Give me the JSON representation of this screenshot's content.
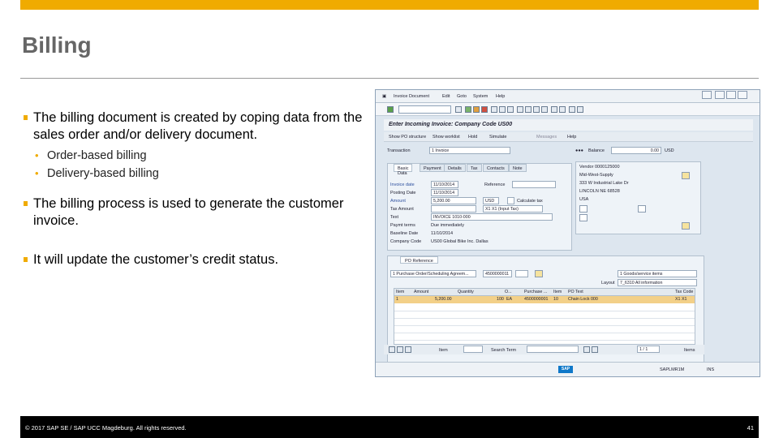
{
  "slide": {
    "title": "Billing",
    "bullets": [
      {
        "text": "The billing document is created by coping data from the sales order and/or delivery document.",
        "sub": [
          "Order-based billing",
          "Delivery-based billing"
        ]
      },
      {
        "text": "The billing process is used to generate the customer invoice.",
        "sub": []
      },
      {
        "text": "It will update the customer’s credit status.",
        "sub": []
      }
    ],
    "footer": {
      "copyright": "© 2017 SAP SE / SAP UCC Magdeburg. All rights reserved.",
      "page_number": "41"
    }
  },
  "sap": {
    "menu": [
      "Invoice Document",
      "Edit",
      "Goto",
      "System",
      "Help"
    ],
    "screen_title": "Enter Incoming Invoice: Company Code US00",
    "app_toolbar": [
      "Show PO structure",
      "Show worklist",
      "Hold",
      "Simulate",
      "Messages",
      "Help"
    ],
    "transaction": {
      "label": "Transaction",
      "value": "1 Invoice"
    },
    "balance": {
      "label": "Balance",
      "value": "0.00",
      "currency": "USD"
    },
    "tabs": [
      "Basic Data",
      "Payment",
      "Details",
      "Tax",
      "Contacts",
      "Note"
    ],
    "basic": {
      "invoice_date": {
        "label": "Invoice date",
        "value": "11/10/2014"
      },
      "reference": {
        "label": "Reference",
        "value": ""
      },
      "posting_date": {
        "label": "Posting Date",
        "value": "11/10/2014"
      },
      "amount": {
        "label": "Amount",
        "value": "5,200.00",
        "currency": "USD"
      },
      "calculate_tax": "Calculate tax",
      "tax_amount": {
        "label": "Tax Amount",
        "value": "",
        "tax_code": "X1 X1 (Input Tax)"
      },
      "text": {
        "label": "Text",
        "value": "INVOICE 1010-000"
      },
      "payment_terms": {
        "label": "Paymt terms",
        "value": "Due immediately"
      },
      "baseline_date": {
        "label": "Baseline Date",
        "value": "11/10/2014"
      },
      "company_code": {
        "label": "Company Code",
        "value": "US00 Global Bike Inc. Dallas"
      }
    },
    "vendor": {
      "number": "Vendor 0000125000",
      "name": "Mid-West-Supply",
      "street": "333 W Industrial Lake Dr",
      "city": "LINCOLN NE 68528",
      "country": "USA"
    },
    "po": {
      "tab": "PO Reference",
      "ref_type": "1 Purchase Order/Scheduling Agreem...",
      "po_number": "4500000011",
      "item_type": "1 Goods/service items",
      "layout_label": "Layout",
      "layout": "7_6310 All information",
      "columns": [
        "Item",
        "Amount",
        "Quantity",
        "O...",
        "Purchase ...",
        "Item",
        "PO Text",
        "Tax Code"
      ],
      "row": [
        "1",
        "5,200.00",
        "100",
        "EA",
        "4500000001",
        "10",
        "Chain Lock 000",
        "X1 X1"
      ],
      "bottom_item_label": "Item",
      "search_term": "Search Term",
      "page": "1 / 1",
      "items_label": "Items"
    },
    "status": {
      "system": "SAP",
      "session": "SAPLMR1M",
      "mode": "INS"
    }
  }
}
